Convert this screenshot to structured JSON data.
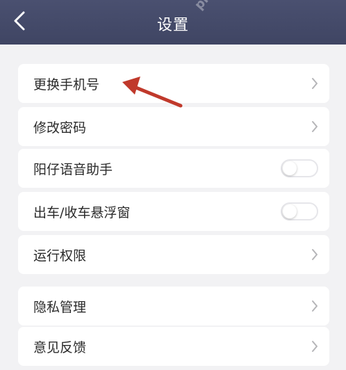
{
  "header": {
    "title": "设置",
    "watermark": "php.cn"
  },
  "groups": [
    {
      "items": [
        {
          "label": "更换手机号",
          "control": "chevron"
        },
        {
          "label": "修改密码",
          "control": "chevron"
        },
        {
          "label": "阳仔语音助手",
          "control": "toggle",
          "state": "off"
        },
        {
          "label": "出车/收车悬浮窗",
          "control": "toggle",
          "state": "off"
        },
        {
          "label": "运行权限",
          "control": "chevron"
        }
      ]
    },
    {
      "items": [
        {
          "label": "隐私管理",
          "control": "chevron"
        },
        {
          "label": "意见反馈",
          "control": "chevron"
        }
      ]
    }
  ],
  "colors": {
    "header_bg": "#434966",
    "page_bg": "#f2f2f4",
    "annotation_arrow": "#c0392b"
  },
  "icons": {
    "back": "chevron-left-icon",
    "row_chevron": "chevron-right-icon",
    "annotation": "red-arrow-icon"
  }
}
